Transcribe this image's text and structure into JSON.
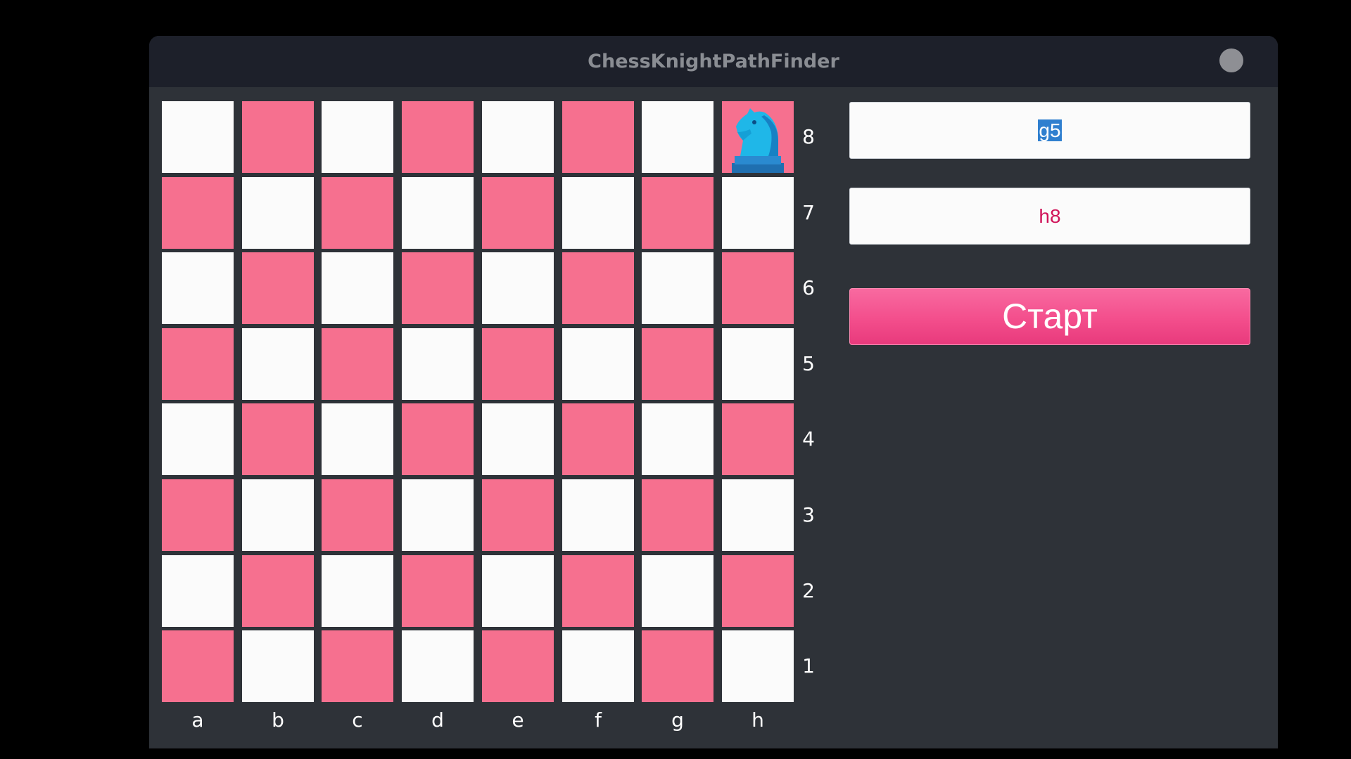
{
  "window": {
    "title": "ChessKnightPathFinder"
  },
  "board": {
    "files": [
      "a",
      "b",
      "c",
      "d",
      "e",
      "f",
      "g",
      "h"
    ],
    "ranks": [
      "8",
      "7",
      "6",
      "5",
      "4",
      "3",
      "2",
      "1"
    ],
    "light_color": "#fbfbfb",
    "dark_color": "#f6708f",
    "knight": {
      "icon": "knight-icon",
      "square": "h8",
      "color": "#1fb7e8"
    }
  },
  "controls": {
    "from_value": "g5",
    "to_value": "h8",
    "start_label": "Старт",
    "accent_color": "#f34e8c"
  }
}
